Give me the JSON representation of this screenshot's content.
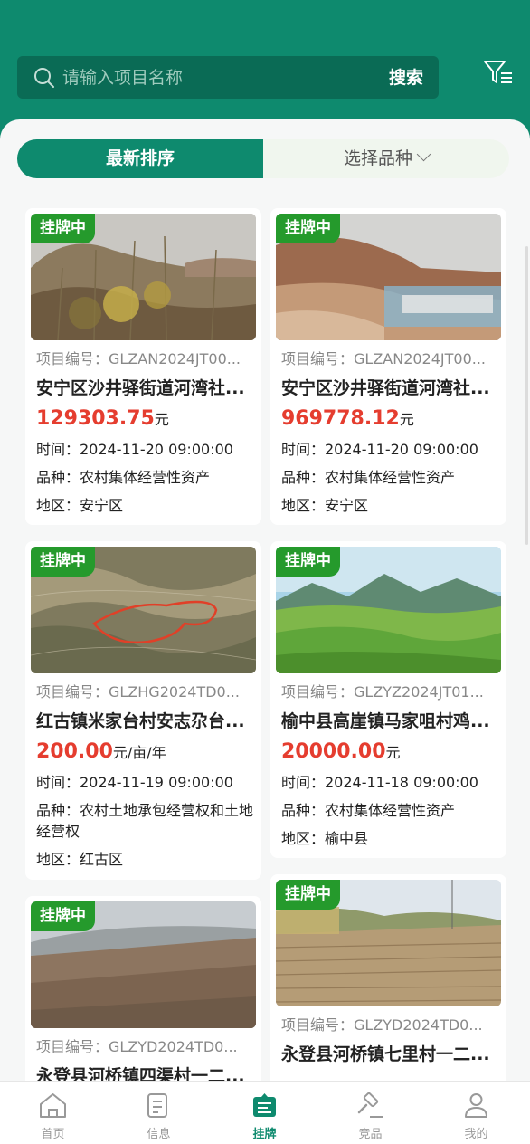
{
  "search": {
    "placeholder": "请输入项目名称",
    "button_label": "搜索"
  },
  "sort": {
    "latest_label": "最新排序",
    "variety_label": "选择品种"
  },
  "colors": {
    "brand": "#0e8a6e",
    "badge": "#259a2c",
    "price": "#e53d2f"
  },
  "listings": [
    {
      "badge": "挂牌中",
      "code": "项目编号：GLZAN2024JT00...",
      "title": "安宁区沙井驿街道河湾社...",
      "price": "129303.75",
      "unit": "元",
      "time": "时间：2024-11-20 09:00:00",
      "variety": "品种：农村集体经营性资产",
      "region": "地区：安宁区"
    },
    {
      "badge": "挂牌中",
      "code": "项目编号：GLZAN2024JT00...",
      "title": "安宁区沙井驿街道河湾社...",
      "price": "969778.12",
      "unit": "元",
      "time": "时间：2024-11-20 09:00:00",
      "variety": "品种：农村集体经营性资产",
      "region": "地区：安宁区"
    },
    {
      "badge": "挂牌中",
      "code": "项目编号：GLZHG2024TD0...",
      "title": "红古镇米家台村安志尕台...",
      "price": "200.00",
      "unit": "元/亩/年",
      "time": "时间：2024-11-19 09:00:00",
      "variety": "品种：农村土地承包经营权和土地经营权",
      "region": "地区：红古区"
    },
    {
      "badge": "挂牌中",
      "code": "项目编号：GLZYZ2024JT01...",
      "title": "榆中县高崖镇马家咀村鸡...",
      "price": "20000.00",
      "unit": "元",
      "time": "时间：2024-11-18 09:00:00",
      "variety": "品种：农村集体经营性资产",
      "region": "地区：榆中县"
    },
    {
      "badge": "挂牌中",
      "code": "项目编号：GLZYD2024TD0...",
      "title": "永登县河桥镇四渠村一二...",
      "price": "",
      "unit": "",
      "time": "",
      "variety": "",
      "region": ""
    },
    {
      "badge": "挂牌中",
      "code": "项目编号：GLZYD2024TD0...",
      "title": "永登县河桥镇七里村一二...",
      "price": "",
      "unit": "",
      "time": "",
      "variety": "",
      "region": ""
    }
  ],
  "tabbar": {
    "items": [
      {
        "label": "首页",
        "icon": "home-icon"
      },
      {
        "label": "信息",
        "icon": "document-icon"
      },
      {
        "label": "挂牌",
        "icon": "listing-icon",
        "active": true
      },
      {
        "label": "竞品",
        "icon": "gavel-icon"
      },
      {
        "label": "我的",
        "icon": "user-icon"
      }
    ]
  }
}
